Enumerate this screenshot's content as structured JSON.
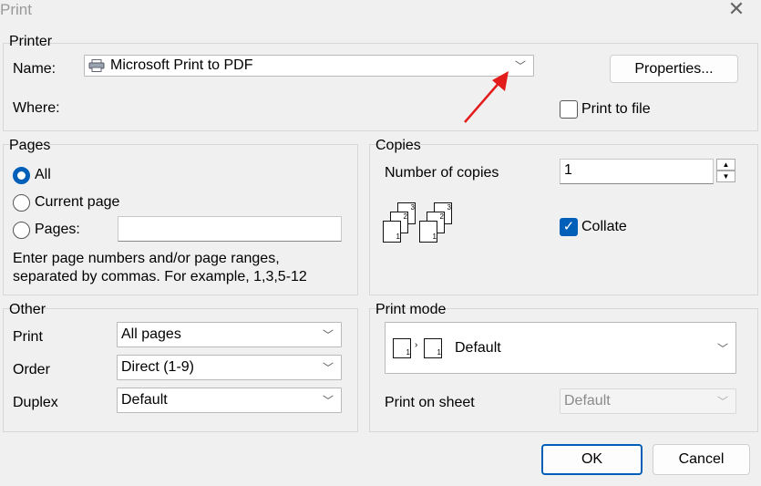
{
  "window": {
    "title": "Print"
  },
  "printer": {
    "group_label": "Printer",
    "name_label": "Name:",
    "name_value": "Microsoft Print to PDF",
    "where_label": "Where:",
    "properties_button": "Properties...",
    "print_to_file_label": "Print to file",
    "print_to_file_checked": false
  },
  "pages": {
    "group_label": "Pages",
    "all_label": "All",
    "current_label": "Current page",
    "pages_label": "Pages:",
    "pages_value": "",
    "selected": "All",
    "hint_line1": "Enter page numbers and/or page ranges,",
    "hint_line2": "separated by commas. For example, 1,3,5-12"
  },
  "copies": {
    "group_label": "Copies",
    "number_label": "Number of copies",
    "number_value": "1",
    "collate_label": "Collate",
    "collate_checked": true
  },
  "other": {
    "group_label": "Other",
    "print_label": "Print",
    "print_value": "All pages",
    "order_label": "Order",
    "order_value": "Direct (1-9)",
    "duplex_label": "Duplex",
    "duplex_value": "Default"
  },
  "print_mode": {
    "group_label": "Print mode",
    "mode_value": "Default",
    "sheet_label": "Print on sheet",
    "sheet_value": "Default"
  },
  "buttons": {
    "ok": "OK",
    "cancel": "Cancel"
  },
  "colors": {
    "accent": "#005fb8",
    "arrow": "#e31b1b"
  }
}
